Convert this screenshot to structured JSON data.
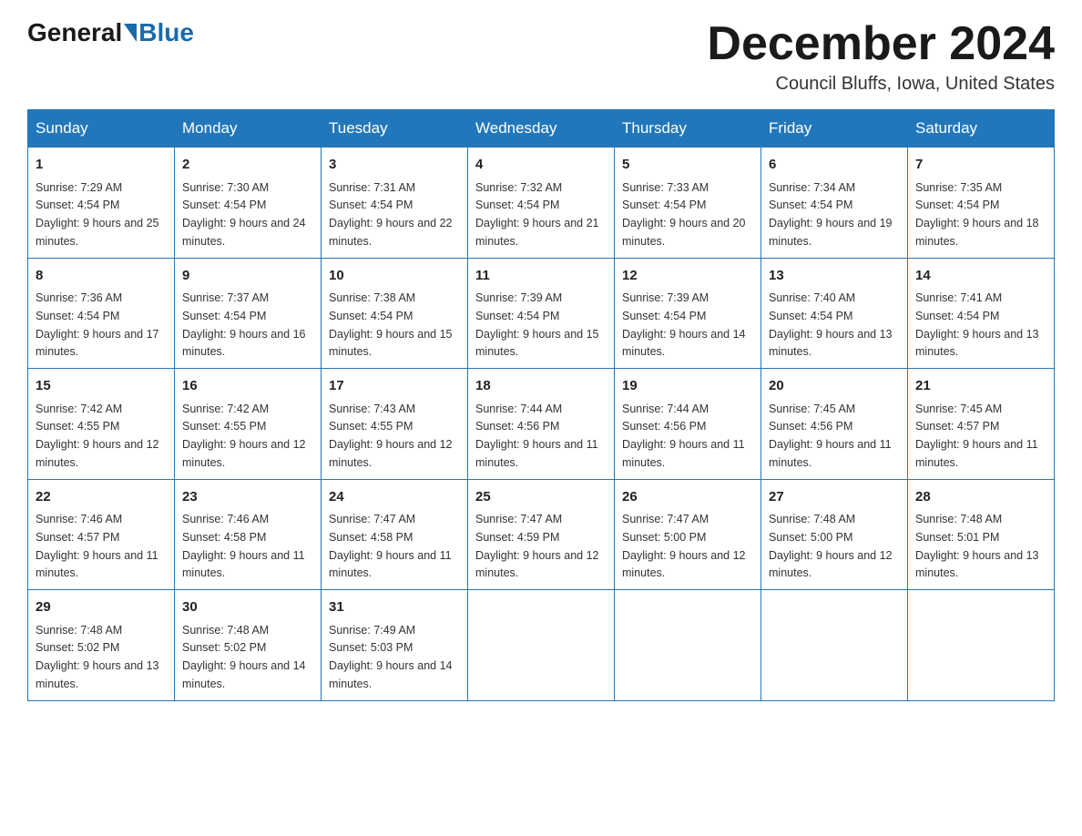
{
  "header": {
    "logo_general": "General",
    "logo_blue": "Blue",
    "month_title": "December 2024",
    "location": "Council Bluffs, Iowa, United States"
  },
  "days_of_week": [
    "Sunday",
    "Monday",
    "Tuesday",
    "Wednesday",
    "Thursday",
    "Friday",
    "Saturday"
  ],
  "weeks": [
    [
      {
        "day": "1",
        "sunrise": "7:29 AM",
        "sunset": "4:54 PM",
        "daylight": "9 hours and 25 minutes."
      },
      {
        "day": "2",
        "sunrise": "7:30 AM",
        "sunset": "4:54 PM",
        "daylight": "9 hours and 24 minutes."
      },
      {
        "day": "3",
        "sunrise": "7:31 AM",
        "sunset": "4:54 PM",
        "daylight": "9 hours and 22 minutes."
      },
      {
        "day": "4",
        "sunrise": "7:32 AM",
        "sunset": "4:54 PM",
        "daylight": "9 hours and 21 minutes."
      },
      {
        "day": "5",
        "sunrise": "7:33 AM",
        "sunset": "4:54 PM",
        "daylight": "9 hours and 20 minutes."
      },
      {
        "day": "6",
        "sunrise": "7:34 AM",
        "sunset": "4:54 PM",
        "daylight": "9 hours and 19 minutes."
      },
      {
        "day": "7",
        "sunrise": "7:35 AM",
        "sunset": "4:54 PM",
        "daylight": "9 hours and 18 minutes."
      }
    ],
    [
      {
        "day": "8",
        "sunrise": "7:36 AM",
        "sunset": "4:54 PM",
        "daylight": "9 hours and 17 minutes."
      },
      {
        "day": "9",
        "sunrise": "7:37 AM",
        "sunset": "4:54 PM",
        "daylight": "9 hours and 16 minutes."
      },
      {
        "day": "10",
        "sunrise": "7:38 AM",
        "sunset": "4:54 PM",
        "daylight": "9 hours and 15 minutes."
      },
      {
        "day": "11",
        "sunrise": "7:39 AM",
        "sunset": "4:54 PM",
        "daylight": "9 hours and 15 minutes."
      },
      {
        "day": "12",
        "sunrise": "7:39 AM",
        "sunset": "4:54 PM",
        "daylight": "9 hours and 14 minutes."
      },
      {
        "day": "13",
        "sunrise": "7:40 AM",
        "sunset": "4:54 PM",
        "daylight": "9 hours and 13 minutes."
      },
      {
        "day": "14",
        "sunrise": "7:41 AM",
        "sunset": "4:54 PM",
        "daylight": "9 hours and 13 minutes."
      }
    ],
    [
      {
        "day": "15",
        "sunrise": "7:42 AM",
        "sunset": "4:55 PM",
        "daylight": "9 hours and 12 minutes."
      },
      {
        "day": "16",
        "sunrise": "7:42 AM",
        "sunset": "4:55 PM",
        "daylight": "9 hours and 12 minutes."
      },
      {
        "day": "17",
        "sunrise": "7:43 AM",
        "sunset": "4:55 PM",
        "daylight": "9 hours and 12 minutes."
      },
      {
        "day": "18",
        "sunrise": "7:44 AM",
        "sunset": "4:56 PM",
        "daylight": "9 hours and 11 minutes."
      },
      {
        "day": "19",
        "sunrise": "7:44 AM",
        "sunset": "4:56 PM",
        "daylight": "9 hours and 11 minutes."
      },
      {
        "day": "20",
        "sunrise": "7:45 AM",
        "sunset": "4:56 PM",
        "daylight": "9 hours and 11 minutes."
      },
      {
        "day": "21",
        "sunrise": "7:45 AM",
        "sunset": "4:57 PM",
        "daylight": "9 hours and 11 minutes."
      }
    ],
    [
      {
        "day": "22",
        "sunrise": "7:46 AM",
        "sunset": "4:57 PM",
        "daylight": "9 hours and 11 minutes."
      },
      {
        "day": "23",
        "sunrise": "7:46 AM",
        "sunset": "4:58 PM",
        "daylight": "9 hours and 11 minutes."
      },
      {
        "day": "24",
        "sunrise": "7:47 AM",
        "sunset": "4:58 PM",
        "daylight": "9 hours and 11 minutes."
      },
      {
        "day": "25",
        "sunrise": "7:47 AM",
        "sunset": "4:59 PM",
        "daylight": "9 hours and 12 minutes."
      },
      {
        "day": "26",
        "sunrise": "7:47 AM",
        "sunset": "5:00 PM",
        "daylight": "9 hours and 12 minutes."
      },
      {
        "day": "27",
        "sunrise": "7:48 AM",
        "sunset": "5:00 PM",
        "daylight": "9 hours and 12 minutes."
      },
      {
        "day": "28",
        "sunrise": "7:48 AM",
        "sunset": "5:01 PM",
        "daylight": "9 hours and 13 minutes."
      }
    ],
    [
      {
        "day": "29",
        "sunrise": "7:48 AM",
        "sunset": "5:02 PM",
        "daylight": "9 hours and 13 minutes."
      },
      {
        "day": "30",
        "sunrise": "7:48 AM",
        "sunset": "5:02 PM",
        "daylight": "9 hours and 14 minutes."
      },
      {
        "day": "31",
        "sunrise": "7:49 AM",
        "sunset": "5:03 PM",
        "daylight": "9 hours and 14 minutes."
      },
      null,
      null,
      null,
      null
    ]
  ],
  "labels": {
    "sunrise": "Sunrise:",
    "sunset": "Sunset:",
    "daylight": "Daylight:"
  }
}
